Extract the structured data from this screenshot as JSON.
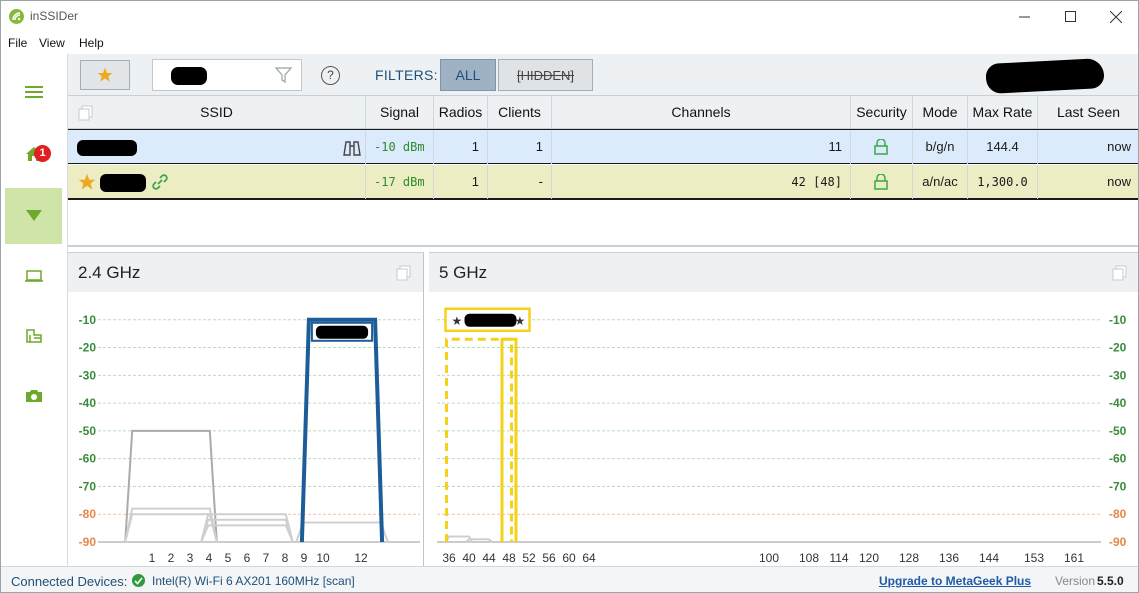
{
  "window": {
    "title": "inSSIDer"
  },
  "menu": [
    "File",
    "View",
    "Help"
  ],
  "toolbar": {
    "filters_label": "FILTERS:",
    "filter_all": "ALL",
    "filter_hidden": "[HIDDEN]",
    "help": "?"
  },
  "sidebar": {
    "notification_count": "1"
  },
  "table": {
    "columns": [
      "SSID",
      "Signal",
      "Radios",
      "Clients",
      "Channels",
      "Security",
      "Mode",
      "Max Rate",
      "Last Seen"
    ],
    "rows": [
      {
        "signal": "-10 dBm",
        "radios": "1",
        "clients": "1",
        "channels": "11",
        "mode": "b/g/n",
        "max_rate": "144.4",
        "last_seen": "now"
      },
      {
        "signal": "-17 dBm",
        "radios": "1",
        "clients": "-",
        "channels": "42 [48]",
        "mode": "a/n/ac",
        "max_rate": "1,300.0",
        "last_seen": "now"
      }
    ]
  },
  "charts": {
    "band_24": {
      "title": "2.4 GHz",
      "y_ticks": [
        "-10",
        "-20",
        "-30",
        "-40",
        "-50",
        "-60",
        "-70",
        "-80",
        "-90"
      ],
      "x_ticks": [
        "1",
        "2",
        "3",
        "4",
        "5",
        "6",
        "7",
        "8",
        "9",
        "10",
        "12"
      ]
    },
    "band_5": {
      "title": "5 GHz",
      "y_ticks": [
        "-10",
        "-20",
        "-30",
        "-40",
        "-50",
        "-60",
        "-70",
        "-80",
        "-90"
      ],
      "x_ticks": [
        "36",
        "40",
        "44",
        "48",
        "52",
        "56",
        "60",
        "64",
        "100",
        "108",
        "114",
        "120",
        "128",
        "136",
        "144",
        "153",
        "161"
      ]
    }
  },
  "chart_data": [
    {
      "type": "area",
      "title": "2.4 GHz",
      "xlabel": "",
      "ylabel": "",
      "ylim": [
        -90,
        0
      ],
      "x_ticks": [
        1,
        2,
        3,
        4,
        5,
        6,
        7,
        8,
        9,
        10,
        12
      ],
      "series": [
        {
          "channel": 11,
          "width_channels": 4,
          "signal_dbm": -10,
          "highlight": true
        },
        {
          "channel": 2,
          "width_channels": 4,
          "signal_dbm": -50
        },
        {
          "channel": 2,
          "width_channels": 4,
          "signal_dbm": -78
        },
        {
          "channel": 2,
          "width_channels": 4,
          "signal_dbm": -80
        },
        {
          "channel": 6,
          "width_channels": 4,
          "signal_dbm": -80
        },
        {
          "channel": 6,
          "width_channels": 4,
          "signal_dbm": -82
        },
        {
          "channel": 6,
          "width_channels": 4,
          "signal_dbm": -84
        },
        {
          "channel": 11,
          "width_channels": 4,
          "signal_dbm": -83
        }
      ]
    },
    {
      "type": "area",
      "title": "5 GHz",
      "xlabel": "",
      "ylabel": "",
      "ylim": [
        -90,
        0
      ],
      "x_ticks": [
        36,
        40,
        44,
        48,
        52,
        56,
        60,
        64,
        100,
        108,
        114,
        120,
        128,
        136,
        144,
        153,
        161
      ],
      "series": [
        {
          "channel": 42,
          "width_channels": 16,
          "signal_dbm": -17,
          "primary_channel": 48,
          "highlight": true
        },
        {
          "channel": 38,
          "width_channels": 4,
          "signal_dbm": -88
        },
        {
          "channel": 42,
          "width_channels": 4,
          "signal_dbm": -89
        }
      ]
    }
  ],
  "status": {
    "label": "Connected Devices:",
    "adapter": "Intel(R) Wi-Fi 6 AX201 160MHz [scan]",
    "upgrade_link": "Upgrade to MetaGeek Plus",
    "version_label": "Version",
    "version_value": "5.5.0"
  },
  "colors": {
    "accent_green": "#86b93a",
    "highlight_blue": "#1b5c99",
    "highlight_yellow": "#f5d21a",
    "gray_network": "#b5b5b5"
  }
}
